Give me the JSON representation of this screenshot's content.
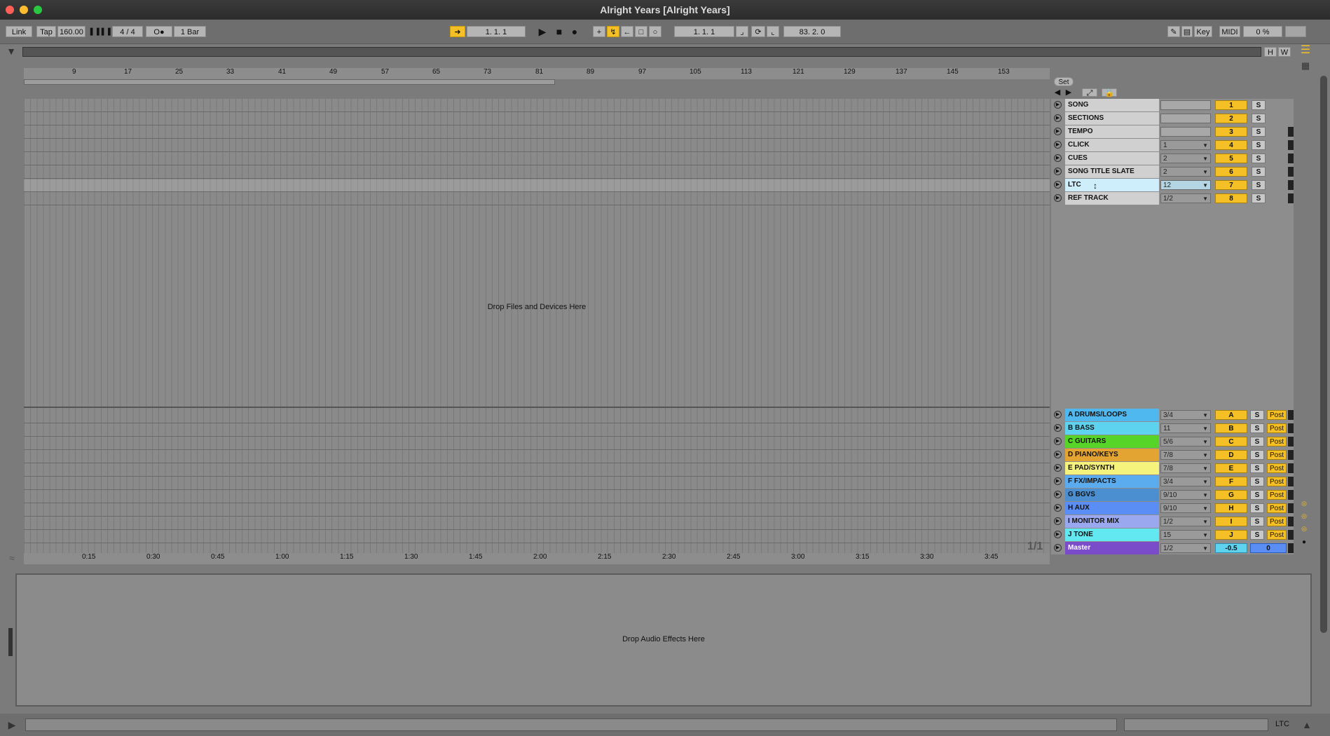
{
  "window": {
    "title": "Alright Years  [Alright Years]"
  },
  "control_bar": {
    "link": "Link",
    "tap": "Tap",
    "tempo": "160.00",
    "time_signature": "4 / 4",
    "metronome": "O●",
    "quantize": "1 Bar",
    "arrangement_position": "1.   1.   1",
    "loop_start": "1.   1.   1",
    "loop_length": "83.   2.   0",
    "key": "Key",
    "midi": "MIDI",
    "cpu": "0 %"
  },
  "overview_buttons": {
    "h": "H",
    "w": "W"
  },
  "ruler": {
    "bars": [
      "9",
      "17",
      "25",
      "33",
      "41",
      "49",
      "57",
      "65",
      "73",
      "81",
      "89",
      "97",
      "105",
      "113",
      "121",
      "129",
      "137",
      "145",
      "153"
    ],
    "times": [
      "0:15",
      "0:30",
      "0:45",
      "1:00",
      "1:15",
      "1:30",
      "1:45",
      "2:00",
      "2:15",
      "2:30",
      "2:45",
      "3:00",
      "3:15",
      "3:30",
      "3:45"
    ]
  },
  "set_button": "Set",
  "arrangement": {
    "drop_text": "Drop Files and Devices Here",
    "page_indicator": "1/1"
  },
  "tracks": [
    {
      "name": "SONG",
      "input": "",
      "number": "1",
      "color": "#d0d0d0"
    },
    {
      "name": "SECTIONS",
      "input": "",
      "number": "2",
      "color": "#d0d0d0"
    },
    {
      "name": "TEMPO",
      "input": "",
      "number": "3",
      "color": "#d0d0d0"
    },
    {
      "name": "CLICK",
      "input": "1",
      "number": "4",
      "color": "#d0d0d0"
    },
    {
      "name": "CUES",
      "input": "2",
      "number": "5",
      "color": "#d0d0d0"
    },
    {
      "name": "SONG TITLE SLATE",
      "input": "2",
      "number": "6",
      "color": "#d0d0d0"
    },
    {
      "name": "LTC",
      "input": "12",
      "number": "7",
      "color": "#cfeefb"
    },
    {
      "name": "REF TRACK",
      "input": "1/2",
      "number": "8",
      "color": "#d0d0d0"
    }
  ],
  "return_tracks": [
    {
      "name": "A DRUMS/LOOPS",
      "input": "3/4",
      "letter": "A",
      "color": "#4fb8ef"
    },
    {
      "name": "B BASS",
      "input": "11",
      "letter": "B",
      "color": "#5ed3f0"
    },
    {
      "name": "C GUITARS",
      "input": "5/6",
      "letter": "C",
      "color": "#57d428"
    },
    {
      "name": "D PIANO/KEYS",
      "input": "7/8",
      "letter": "D",
      "color": "#e3a431"
    },
    {
      "name": "E PAD/SYNTH",
      "input": "7/8",
      "letter": "E",
      "color": "#f6f37c"
    },
    {
      "name": "F FX/IMPACTS",
      "input": "3/4",
      "letter": "F",
      "color": "#5aacef"
    },
    {
      "name": "G BGVS",
      "input": "9/10",
      "letter": "G",
      "color": "#4b8fd0"
    },
    {
      "name": "H AUX",
      "input": "9/10",
      "letter": "H",
      "color": "#5a8ef5"
    },
    {
      "name": "I MONITOR MIX",
      "input": "1/2",
      "letter": "I",
      "color": "#9aa8ef"
    },
    {
      "name": "J TONE",
      "input": "15",
      "letter": "J",
      "color": "#62e8f1"
    }
  ],
  "master": {
    "name": "Master",
    "input": "1/2",
    "volume": "-0.5",
    "pan": "0",
    "color": "#7a4cc9"
  },
  "solo_label": "S",
  "post_label": "Post",
  "detail": {
    "drop_text": "Drop Audio Effects Here"
  },
  "status_bar": {
    "right_label": "LTC"
  }
}
